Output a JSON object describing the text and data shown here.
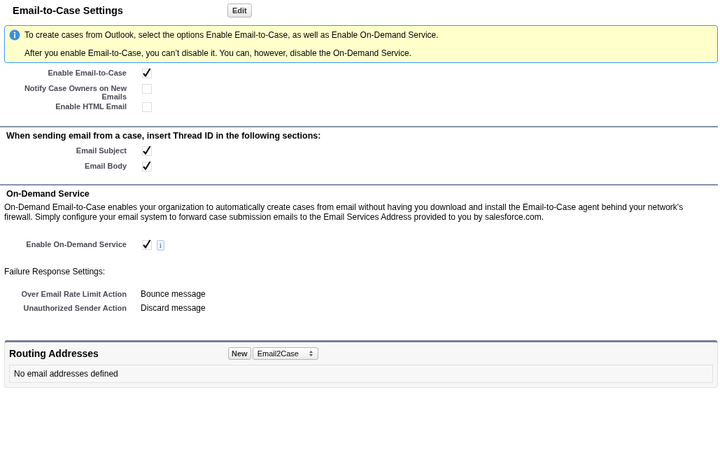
{
  "header": {
    "title": "Email-to-Case Settings",
    "edit_button": "Edit"
  },
  "info": {
    "lines": [
      "To create cases from Outlook, select the options Enable Email-to-Case, as well as Enable On-Demand Service.",
      "After you enable Email-to-Case, you can’t disable it. You can, however, disable the On-Demand Service."
    ]
  },
  "settings": [
    {
      "label": "Enable Email-to-Case",
      "checked": true
    },
    {
      "label": "Notify Case Owners on New Emails",
      "checked": false
    },
    {
      "label": "Enable HTML Email",
      "checked": false
    }
  ],
  "thread_section": {
    "title": "When sending email from a case, insert Thread ID in the following sections:",
    "fields": [
      {
        "label": "Email Subject",
        "checked": true
      },
      {
        "label": "Email Body",
        "checked": true
      }
    ]
  },
  "on_demand": {
    "title": "On-Demand Service",
    "description": "On-Demand Email-to-Case enables your organization to automatically create cases from email without having you download and install the Email-to-Case agent behind your network's firewall. Simply configure your email system to forward case submission emails to the Email Services Address provided to you by salesforce.com.",
    "enable": {
      "label": "Enable On-Demand Service",
      "checked": true,
      "info_button": "i"
    },
    "failure_title": "Failure Response Settings:",
    "failure_fields": [
      {
        "label": "Over Email Rate Limit Action",
        "value": "Bounce message"
      },
      {
        "label": "Unauthorized Sender Action",
        "value": "Discard message"
      }
    ]
  },
  "routing": {
    "title": "Routing Addresses",
    "new_button": "New",
    "select": "Email2Case",
    "empty": "No email addresses defined"
  }
}
